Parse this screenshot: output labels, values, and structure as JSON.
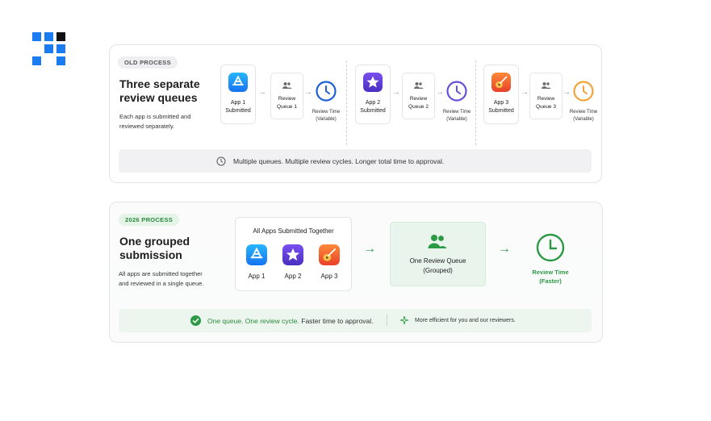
{
  "old": {
    "badge": "OLD PROCESS",
    "title_line1": "Three separate",
    "title_line2": "review queues",
    "desc_line1": "Each app is submitted and",
    "desc_line2": "reviewed separately.",
    "flows": [
      {
        "app_line1": "App 1",
        "app_line2": "Submitted",
        "queue_line1": "Review",
        "queue_line2": "Queue 1",
        "rt_line1": "Review Time",
        "rt_line2": "(Variable)",
        "color": "#1a8cff",
        "clock": "#1f5fd6"
      },
      {
        "app_line1": "App 2",
        "app_line2": "Submitted",
        "queue_line1": "Review",
        "queue_line2": "Queue 2",
        "rt_line1": "Review Time",
        "rt_line2": "(Variable)",
        "color": "#5b3fd6",
        "clock": "#6a4fd8"
      },
      {
        "app_line1": "App 3",
        "app_line2": "Submitted",
        "queue_line1": "Review",
        "queue_line2": "Queue 3",
        "rt_line1": "Review Time",
        "rt_line2": "(Variable)",
        "color": "#f0663a",
        "clock": "#f2a43a"
      }
    ],
    "footer": "Multiple queues. Multiple review cycles. Longer total time to approval."
  },
  "new": {
    "badge": "2026 PROCESS",
    "title_line1": "One grouped",
    "title_line2": "submission",
    "desc_line1": "All apps are submitted together",
    "desc_line2": "and reviewed in a single queue.",
    "group_title": "All Apps Submitted Together",
    "apps": [
      "App 1",
      "App 2",
      "App 3"
    ],
    "queue_line1": "One Review Queue",
    "queue_line2": "(Grouped)",
    "rt_line1": "Review Time",
    "rt_line2": "(Faster)",
    "footer_bold": "One queue. One review cycle.",
    "footer_rest": "Faster time to approval.",
    "footer_right": "More efficient for you and our reviewers.",
    "accent": "#2c9a45"
  },
  "icons": [
    "app-store-icon",
    "imovie-star-icon",
    "garageband-guitar-icon",
    "people-icon",
    "clock-icon",
    "check-circle-icon",
    "sparkle-icon",
    "logo-icon"
  ]
}
